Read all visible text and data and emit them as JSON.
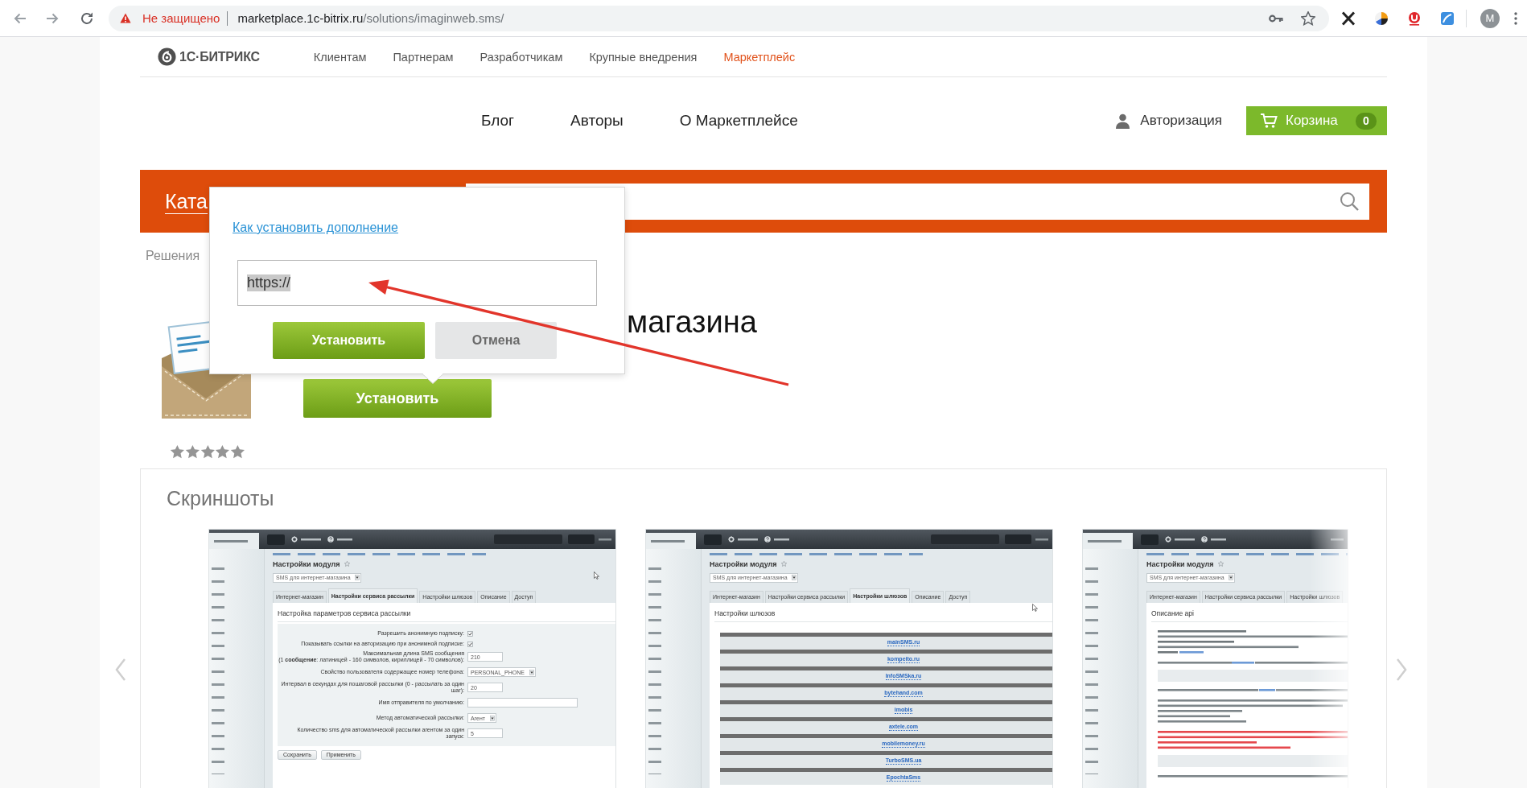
{
  "browser": {
    "security_label": "Не защищено",
    "url_host": "marketplace.1c-bitrix.ru",
    "url_path": "/solutions/imaginweb.sms/",
    "profile_initial": "M"
  },
  "top_nav": {
    "logo": "1С·БИТРИКС",
    "items": [
      {
        "label": "Клиентам",
        "selected": false
      },
      {
        "label": "Партнерам",
        "selected": false
      },
      {
        "label": "Разработчикам",
        "selected": false
      },
      {
        "label": "Крупные внедрения",
        "selected": false
      },
      {
        "label": "Маркетплейс",
        "selected": true
      }
    ]
  },
  "sub_nav": {
    "items": [
      "Блог",
      "Авторы",
      "О Маркетплейсе"
    ],
    "login": "Авторизация",
    "cart": {
      "label": "Корзина",
      "count": "0"
    }
  },
  "catalog_bar": {
    "title": "Ката"
  },
  "breadcrumb": [
    "Решения"
  ],
  "product": {
    "title": "магазина",
    "install_button": "Установить",
    "stars": 5
  },
  "install_popup": {
    "help_link": "Как установить дополнение",
    "url_value": "https://",
    "url_selected": true,
    "buttons": [
      {
        "label": "Установить",
        "kind": "primary"
      },
      {
        "label": "Отмена",
        "kind": "secondary"
      }
    ]
  },
  "screenshots": {
    "title": "Скриншоты",
    "slides": [
      {
        "kind": "form",
        "page_title": "Настройки модуля",
        "module_select": "SMS для интернет-магазина",
        "tabs": [
          {
            "label": "Интернет-магазин",
            "selected": false
          },
          {
            "label": "Настройки сервиса рассылки",
            "selected": true
          },
          {
            "label": "Настройки шлюзов",
            "selected": false
          },
          {
            "label": "Описание",
            "selected": false
          },
          {
            "label": "Доступ",
            "selected": false
          }
        ],
        "heading": "Настройка параметров сервиса рассылки",
        "fields": [
          {
            "kind": "checkbox",
            "label": "Разрешить анонимную подписку:",
            "checked": true
          },
          {
            "kind": "checkbox",
            "label": "Показывать ссылки на авторизацию при анонимной подписке:",
            "checked": true
          },
          {
            "kind": "text",
            "label": "Максимальная длина SMS сообщения",
            "note": "(1 **сообщение**: латиницей - 160 символов, кириллицей - 70 символов):",
            "value": "210"
          },
          {
            "kind": "select",
            "label": "Свойство пользователя содержащее номер телефона:",
            "value": "PERSONAL_PHONE"
          },
          {
            "kind": "text",
            "label": "Интервал в секундах для пошаговой рассылки (0 - рассылать за один шаг):",
            "value": "20"
          },
          {
            "kind": "text",
            "label": "Имя отправителя по умолчанию:"
          },
          {
            "kind": "select",
            "label": "Метод автоматической рассылки:",
            "value": "Агент"
          },
          {
            "kind": "text",
            "label": "Количество sms для автоматической рассылки агентом за один запуск:",
            "value": "5"
          }
        ],
        "buttons": [
          "Сохранить",
          "Применить"
        ]
      },
      {
        "kind": "gateways",
        "page_title": "Настройки модуля",
        "module_select": "SMS для интернет-магазина",
        "tabs": [
          {
            "label": "Интернет-магазин",
            "selected": false
          },
          {
            "label": "Настройки сервиса рассылки",
            "selected": false
          },
          {
            "label": "Настройки шлюзов",
            "selected": true
          },
          {
            "label": "Описание",
            "selected": false
          },
          {
            "label": "Доступ",
            "selected": false
          }
        ],
        "heading": "Настройки шлюзов",
        "gateways": [
          "mainSMS.ru",
          "kompeito.ru",
          "InfoSMSka.ru",
          "bytehand.com",
          "imobis",
          "axtele.com",
          "mobilemoney.ru",
          "TurboSMS.ua",
          "EpochtaSms"
        ]
      },
      {
        "kind": "api",
        "page_title": "Настройки модуля",
        "module_select": "SMS для интернет-магазина",
        "tabs": [
          {
            "label": "Интернет-магазин",
            "selected": false
          },
          {
            "label": "Настройки сервиса рассылки",
            "selected": false
          },
          {
            "label": "Настройки шлюзов",
            "selected": false
          }
        ],
        "heading": "Описание api"
      }
    ]
  }
}
